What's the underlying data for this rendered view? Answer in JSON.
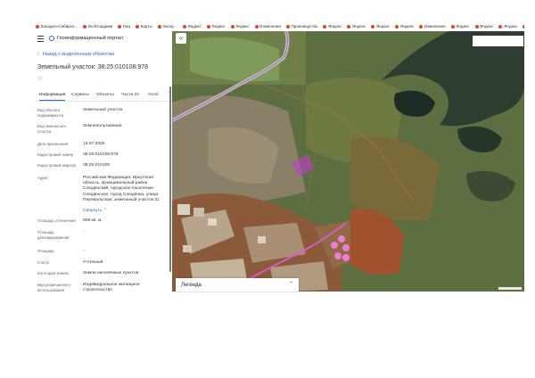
{
  "bookmarks": [
    "Западно-Сибирск...",
    "Из Игнадами",
    "Пиц",
    "Карты",
    "Экспр...",
    "Яндекс",
    "Яндекс",
    "Яндекс",
    "Изменения",
    "Производство",
    "Яндекс",
    "Яндекс",
    "Яндекс",
    "Яндекс",
    "Изменения",
    "Яндекс",
    "Яндекс",
    "Яндекс",
    "Яндекс",
    "Дом",
    "Кадастр...",
    "Яндекс",
    "Карты",
    "Яндекс",
    "Яндекс"
  ],
  "header": {
    "portal_title": "Геоинформационный портал"
  },
  "back_link": "Назад к выделенным объектам",
  "page_title": "Земельный участок: 38:25:010108:978",
  "tabs": [
    "Информация",
    "Сервисы",
    "Объекты",
    "Части ЗУ",
    "Особ"
  ],
  "fields": [
    {
      "label": "Вид объекта недвижимости",
      "value": "Земельный участок"
    },
    {
      "label": "Вид земельного участка",
      "value": "Землепользование"
    },
    {
      "label": "Дата присвоения",
      "value": "15.07.2025"
    },
    {
      "label": "Кадастровый номер",
      "value": "38:25:010108:978"
    },
    {
      "label": "Кадастровый квартал",
      "value": "38:25:010108"
    },
    {
      "label": "Адрес",
      "value": "Российская Федерация, Иркутская область, муниципальный район Слюдянский, городское поселение Слюдянское, город Слюдянка, улица Перевальская, земельный участок 31"
    },
    {
      "label": "Площадь уточненная",
      "value": "908 кв. м"
    },
    {
      "label": "Площадь декларированная",
      "value": "-"
    },
    {
      "label": "Площадь",
      "value": "-"
    },
    {
      "label": "Статус",
      "value": "Учтенный"
    },
    {
      "label": "Категория земель",
      "value": "Земли населённых пунктов"
    },
    {
      "label": "Вид разрешенного использования",
      "value": "Индивидуальное жилищное строительство"
    }
  ],
  "collapse_link": "Свернуть",
  "map": {
    "legend_title": "Легенда",
    "collapse_icon": "double-chevron-left-icon"
  },
  "colors": {
    "accent": "#2b6ad1",
    "parcel": "#c23bd4",
    "tanks": "#f07ad8"
  }
}
